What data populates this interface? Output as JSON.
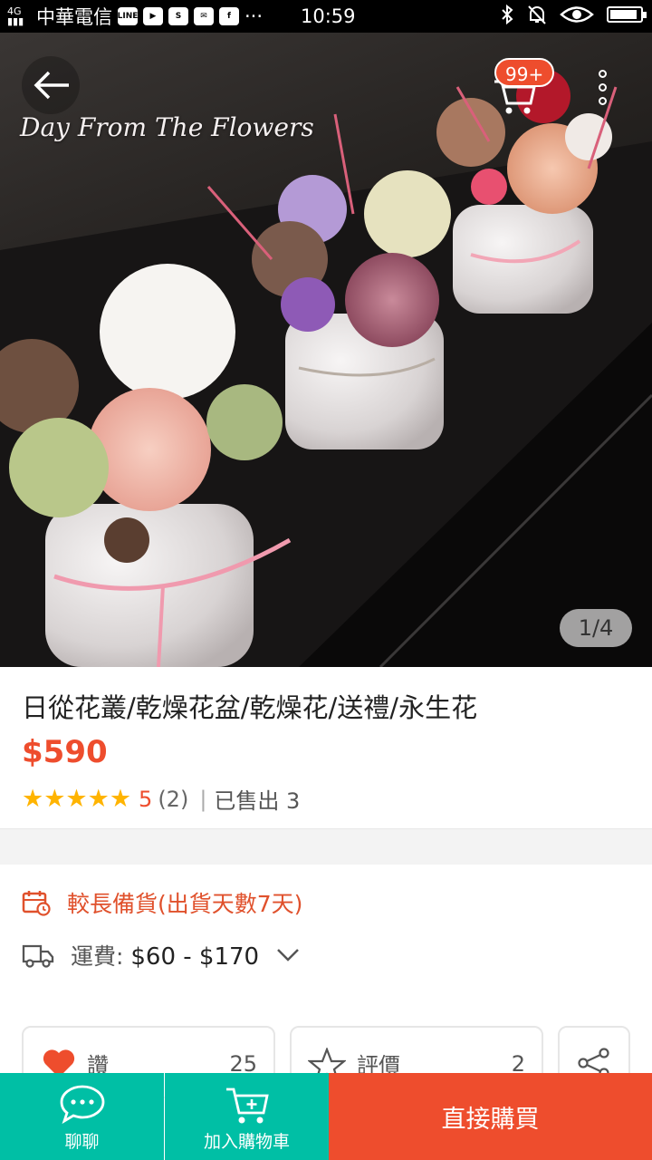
{
  "status_bar": {
    "carrier": "中華電信",
    "time": "10:59",
    "signal": "4G\nLTE",
    "apps": [
      "LINE",
      "▶",
      "S",
      "✉",
      "f",
      "···"
    ]
  },
  "hero": {
    "brand_text": "Day From The Flowers",
    "cart_badge": "99+",
    "pager": "1/4"
  },
  "product": {
    "title": "日從花叢/乾燥花盆/乾燥花/送禮/永生花",
    "price": "$590",
    "stars": "★★★★★",
    "rating_score": "5",
    "rating_count": "(2)",
    "separator": "|",
    "sold": "已售出 3"
  },
  "shipping": {
    "preorder": "較長備貨(出貨天數7天)",
    "fee_label": "運費:",
    "fee_value": "$60 - $170"
  },
  "actions": {
    "like_label": "讚",
    "like_count": "25",
    "review_label": "評價",
    "review_count": "2"
  },
  "bottom_bar": {
    "chat_label": "聊聊",
    "cart_label": "加入購物車",
    "buy_label": "直接購買"
  },
  "colors": {
    "accent": "#ee4d2d",
    "teal": "#00bfa5",
    "star": "#ffb400"
  },
  "icons": [
    "back-arrow-icon",
    "cart-icon",
    "more-icon",
    "calendar-clock-icon",
    "truck-icon",
    "chevron-down-icon",
    "heart-icon",
    "star-outline-icon",
    "share-icon",
    "chat-icon",
    "cart-add-icon"
  ]
}
